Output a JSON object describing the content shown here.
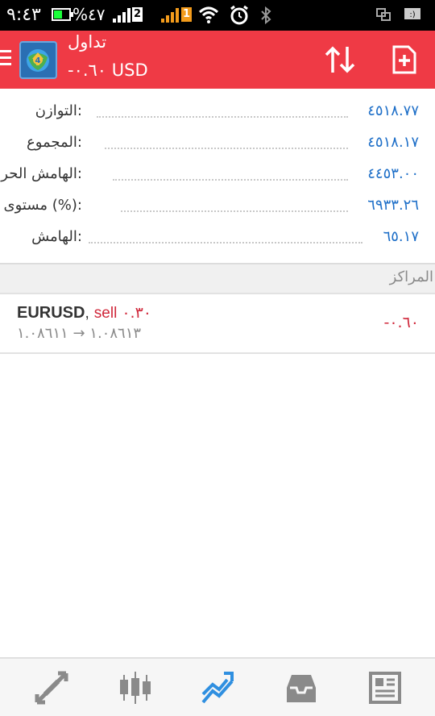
{
  "status_bar": {
    "time": "٩:٤٣",
    "battery_pct": "%٤٧",
    "sim1": "2",
    "sim2": "1"
  },
  "app_bar": {
    "title": "تداول",
    "subtitle": "-٠.٦٠ USD",
    "accent_color": "#ef3a45"
  },
  "summary": [
    {
      "label": "التوازن:",
      "value": "٤٥١٨.٧٧"
    },
    {
      "label": "المجموع:",
      "value": "٤٥١٨.١٧"
    },
    {
      "label": "الهامش الحر:",
      "value": "٤٤٥٣.٠٠"
    },
    {
      "label": "مستوى (%):",
      "value": "٦٩٣٣.٢٦"
    },
    {
      "label": "الهامش:",
      "value": "٦٥.١٧"
    }
  ],
  "positions_section": {
    "title": "المراكز"
  },
  "positions": [
    {
      "symbol": "EURUSD",
      "separator": ",",
      "direction": "sell",
      "volume": "٠.٣٠",
      "open_price": "١.٠٨٦١٣",
      "arrow": "→",
      "current_price": "١.٠٨٦١١",
      "profit": "-٠.٦٠"
    }
  ],
  "bottom_nav": [
    {
      "name": "quotes",
      "icon": "arrows-icon"
    },
    {
      "name": "chart",
      "icon": "candlestick-icon"
    },
    {
      "name": "trade",
      "icon": "trend-icon",
      "active": true
    },
    {
      "name": "history",
      "icon": "inbox-icon"
    },
    {
      "name": "news",
      "icon": "newspaper-icon"
    }
  ],
  "colors": {
    "value_blue": "#1e6fc8",
    "loss_red": "#d0273a",
    "active_nav": "#2f8fe0",
    "inactive_nav": "#8a8a8a"
  }
}
